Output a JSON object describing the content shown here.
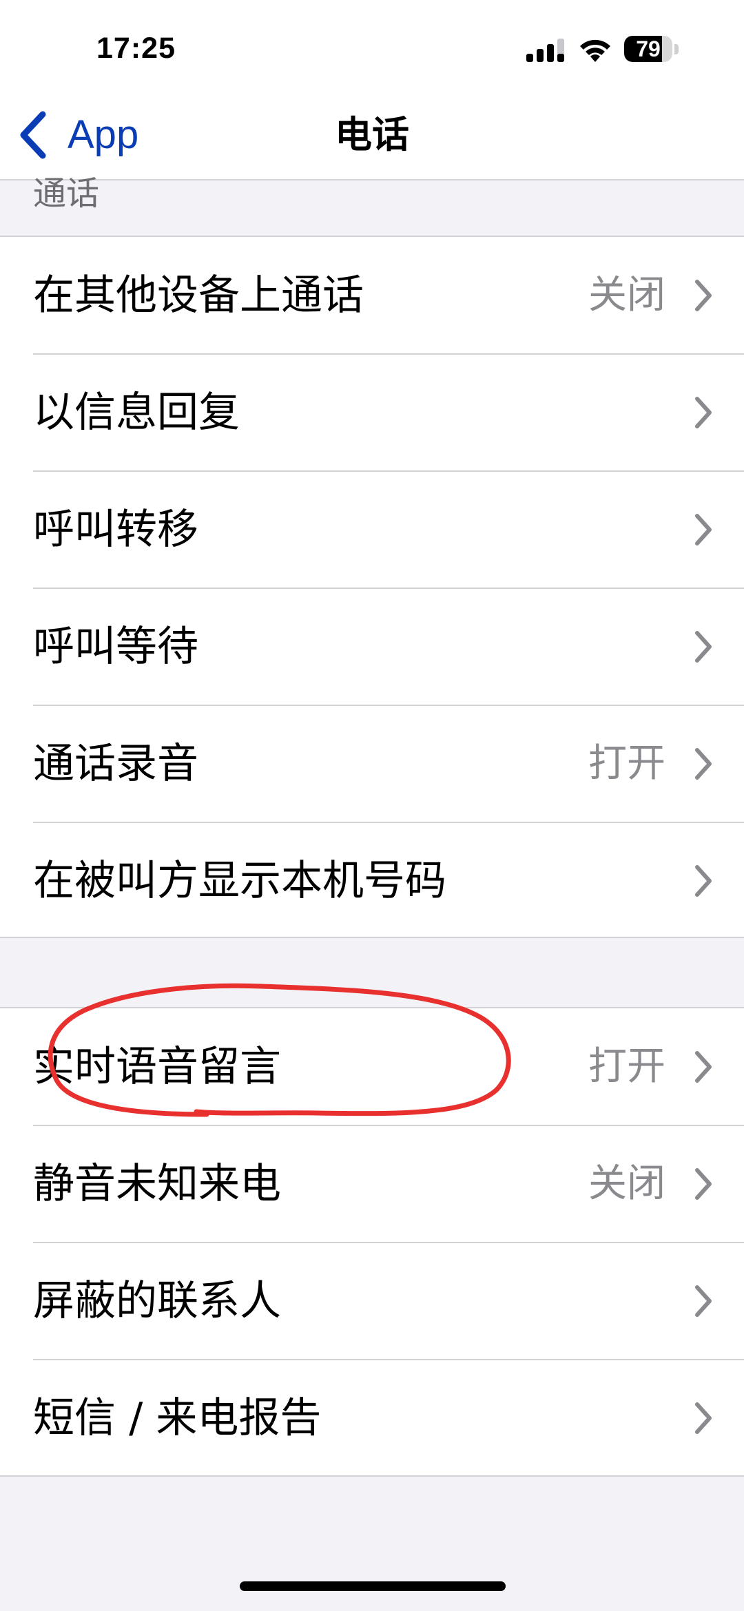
{
  "status_bar": {
    "time": "17:25",
    "battery_level": "79",
    "battery_fraction": 0.79,
    "signal_icon": "cellular-signal-icon",
    "wifi_icon": "wifi-icon"
  },
  "nav": {
    "back_label": "App",
    "back_icon": "chevron-left-icon",
    "title": "电话"
  },
  "section_header": "通话",
  "group1": [
    {
      "label": "在其他设备上通话",
      "value": "关闭"
    },
    {
      "label": "以信息回复",
      "value": ""
    },
    {
      "label": "呼叫转移",
      "value": ""
    },
    {
      "label": "呼叫等待",
      "value": ""
    },
    {
      "label": "通话录音",
      "value": "打开"
    },
    {
      "label": "在被叫方显示本机号码",
      "value": ""
    }
  ],
  "group2": [
    {
      "label": "实时语音留言",
      "value": "打开"
    },
    {
      "label": "静音未知来电",
      "value": "关闭"
    },
    {
      "label": "屏蔽的联系人",
      "value": ""
    },
    {
      "label": "短信 / 来电报告",
      "value": ""
    }
  ],
  "colors": {
    "accent": "#0a3db5",
    "background": "#f2f2f7",
    "annotation": "#e8302e",
    "secondary_text": "#8a8a8e"
  }
}
